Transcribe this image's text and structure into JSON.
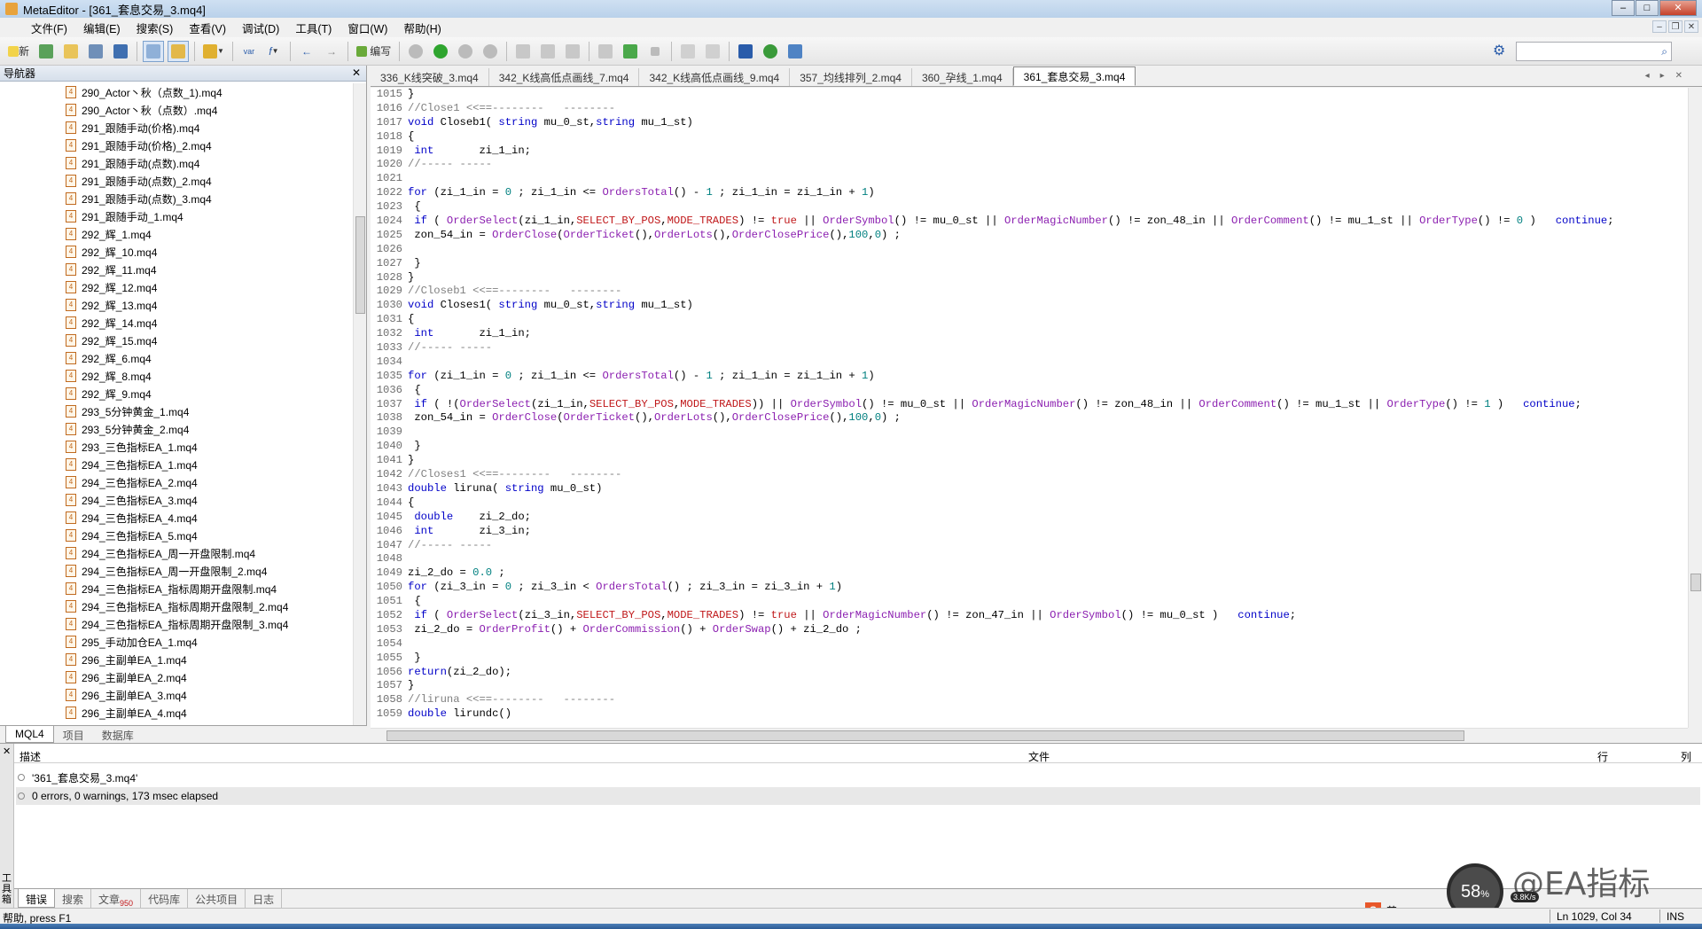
{
  "window": {
    "title": "MetaEditor - [361_套息交易_3.mq4]"
  },
  "menu": [
    "文件(F)",
    "编辑(E)",
    "搜索(S)",
    "查看(V)",
    "调试(D)",
    "工具(T)",
    "窗口(W)",
    "帮助(H)"
  ],
  "toolbar": {
    "new_label": "新",
    "var_label": "var",
    "compile_label": "编写"
  },
  "search": {
    "placeholder": ""
  },
  "navigator": {
    "title": "导航器",
    "items": [
      "290_Actor丶秋（点数_1).mq4",
      "290_Actor丶秋（点数）.mq4",
      "291_跟随手动(价格).mq4",
      "291_跟随手动(价格)_2.mq4",
      "291_跟随手动(点数).mq4",
      "291_跟随手动(点数)_2.mq4",
      "291_跟随手动(点数)_3.mq4",
      "291_跟随手动_1.mq4",
      "292_辉_1.mq4",
      "292_辉_10.mq4",
      "292_辉_11.mq4",
      "292_辉_12.mq4",
      "292_辉_13.mq4",
      "292_辉_14.mq4",
      "292_辉_15.mq4",
      "292_辉_6.mq4",
      "292_辉_8.mq4",
      "292_辉_9.mq4",
      "293_5分钟黄金_1.mq4",
      "293_5分钟黄金_2.mq4",
      "293_三色指标EA_1.mq4",
      "294_三色指标EA_1.mq4",
      "294_三色指标EA_2.mq4",
      "294_三色指标EA_3.mq4",
      "294_三色指标EA_4.mq4",
      "294_三色指标EA_5.mq4",
      "294_三色指标EA_周一开盘限制.mq4",
      "294_三色指标EA_周一开盘限制_2.mq4",
      "294_三色指标EA_指标周期开盘限制.mq4",
      "294_三色指标EA_指标周期开盘限制_2.mq4",
      "294_三色指标EA_指标周期开盘限制_3.mq4",
      "295_手动加仓EA_1.mq4",
      "296_主副单EA_1.mq4",
      "296_主副单EA_2.mq4",
      "296_主副单EA_3.mq4",
      "296_主副单EA_4.mq4"
    ],
    "tabs": [
      "MQL4",
      "项目",
      "数据库"
    ]
  },
  "editor_tabs": [
    "336_K线突破_3.mq4",
    "342_K线高低点画线_7.mq4",
    "342_K线高低点画线_9.mq4",
    "357_均线排列_2.mq4",
    "360_孕线_1.mq4",
    "361_套息交易_3.mq4"
  ],
  "code_lines": [
    {
      "n": "1015",
      "t": "}"
    },
    {
      "n": "1016",
      "t": "//Close1 <<==--------   --------"
    },
    {
      "n": "1017",
      "t": "void Closeb1( string mu_0_st,string mu_1_st)"
    },
    {
      "n": "1018",
      "t": "{"
    },
    {
      "n": "1019",
      "t": " int       zi_1_in;"
    },
    {
      "n": "1020",
      "t": "//----- -----"
    },
    {
      "n": "1021",
      "t": ""
    },
    {
      "n": "1022",
      "t": "for (zi_1_in = 0 ; zi_1_in <= OrdersTotal() - 1 ; zi_1_in = zi_1_in + 1)"
    },
    {
      "n": "1023",
      "t": " {"
    },
    {
      "n": "1024",
      "t": " if ( OrderSelect(zi_1_in,SELECT_BY_POS,MODE_TRADES) != true || OrderSymbol() != mu_0_st || OrderMagicNumber() != zon_48_in || OrderComment() != mu_1_st || OrderType() != 0 )   continue;"
    },
    {
      "n": "1025",
      "t": " zon_54_in = OrderClose(OrderTicket(),OrderLots(),OrderClosePrice(),100,0) ;"
    },
    {
      "n": "1026",
      "t": ""
    },
    {
      "n": "1027",
      "t": " }"
    },
    {
      "n": "1028",
      "t": "}"
    },
    {
      "n": "1029",
      "t": "//Closeb1 <<==--------   --------"
    },
    {
      "n": "1030",
      "t": "void Closes1( string mu_0_st,string mu_1_st)"
    },
    {
      "n": "1031",
      "t": "{"
    },
    {
      "n": "1032",
      "t": " int       zi_1_in;"
    },
    {
      "n": "1033",
      "t": "//----- -----"
    },
    {
      "n": "1034",
      "t": ""
    },
    {
      "n": "1035",
      "t": "for (zi_1_in = 0 ; zi_1_in <= OrdersTotal() - 1 ; zi_1_in = zi_1_in + 1)"
    },
    {
      "n": "1036",
      "t": " {"
    },
    {
      "n": "1037",
      "t": " if ( !(OrderSelect(zi_1_in,SELECT_BY_POS,MODE_TRADES)) || OrderSymbol() != mu_0_st || OrderMagicNumber() != zon_48_in || OrderComment() != mu_1_st || OrderType() != 1 )   continue;"
    },
    {
      "n": "1038",
      "t": " zon_54_in = OrderClose(OrderTicket(),OrderLots(),OrderClosePrice(),100,0) ;"
    },
    {
      "n": "1039",
      "t": ""
    },
    {
      "n": "1040",
      "t": " }"
    },
    {
      "n": "1041",
      "t": "}"
    },
    {
      "n": "1042",
      "t": "//Closes1 <<==--------   --------"
    },
    {
      "n": "1043",
      "t": "double liruna( string mu_0_st)"
    },
    {
      "n": "1044",
      "t": "{"
    },
    {
      "n": "1045",
      "t": " double    zi_2_do;"
    },
    {
      "n": "1046",
      "t": " int       zi_3_in;"
    },
    {
      "n": "1047",
      "t": "//----- -----"
    },
    {
      "n": "1048",
      "t": ""
    },
    {
      "n": "1049",
      "t": "zi_2_do = 0.0 ;"
    },
    {
      "n": "1050",
      "t": "for (zi_3_in = 0 ; zi_3_in < OrdersTotal() ; zi_3_in = zi_3_in + 1)"
    },
    {
      "n": "1051",
      "t": " {"
    },
    {
      "n": "1052",
      "t": " if ( OrderSelect(zi_3_in,SELECT_BY_POS,MODE_TRADES) != true || OrderMagicNumber() != zon_47_in || OrderSymbol() != mu_0_st )   continue;"
    },
    {
      "n": "1053",
      "t": " zi_2_do = OrderProfit() + OrderCommission() + OrderSwap() + zi_2_do ;"
    },
    {
      "n": "1054",
      "t": ""
    },
    {
      "n": "1055",
      "t": " }"
    },
    {
      "n": "1056",
      "t": "return(zi_2_do);"
    },
    {
      "n": "1057",
      "t": "}"
    },
    {
      "n": "1058",
      "t": "//liruna <<==--------   --------"
    },
    {
      "n": "1059",
      "t": "double lirundc()"
    }
  ],
  "toolbox": {
    "headers": {
      "desc": "描述",
      "file": "文件",
      "line": "行",
      "col": "列"
    },
    "messages": [
      "'361_套息交易_3.mq4'",
      "0 errors, 0 warnings, 173 msec elapsed"
    ],
    "tabs": [
      "错误",
      "搜索",
      "文章",
      "代码库",
      "公共项目",
      "日志"
    ],
    "articles_badge": "950",
    "side_label": "工具箱"
  },
  "status": {
    "help": "帮助, press F1",
    "position": "Ln 1029, Col 34",
    "mode": "INS"
  },
  "overlay": {
    "percent": "58",
    "percent_unit": "%",
    "speed": "3.8K/s",
    "watermark": "@EA指标"
  },
  "ime": {
    "lang": "英"
  },
  "colors": {
    "keyword": "#0000c8",
    "function": "#8b1fb0",
    "constant": "#c0181a",
    "number": "#008080",
    "comment": "#808080"
  }
}
